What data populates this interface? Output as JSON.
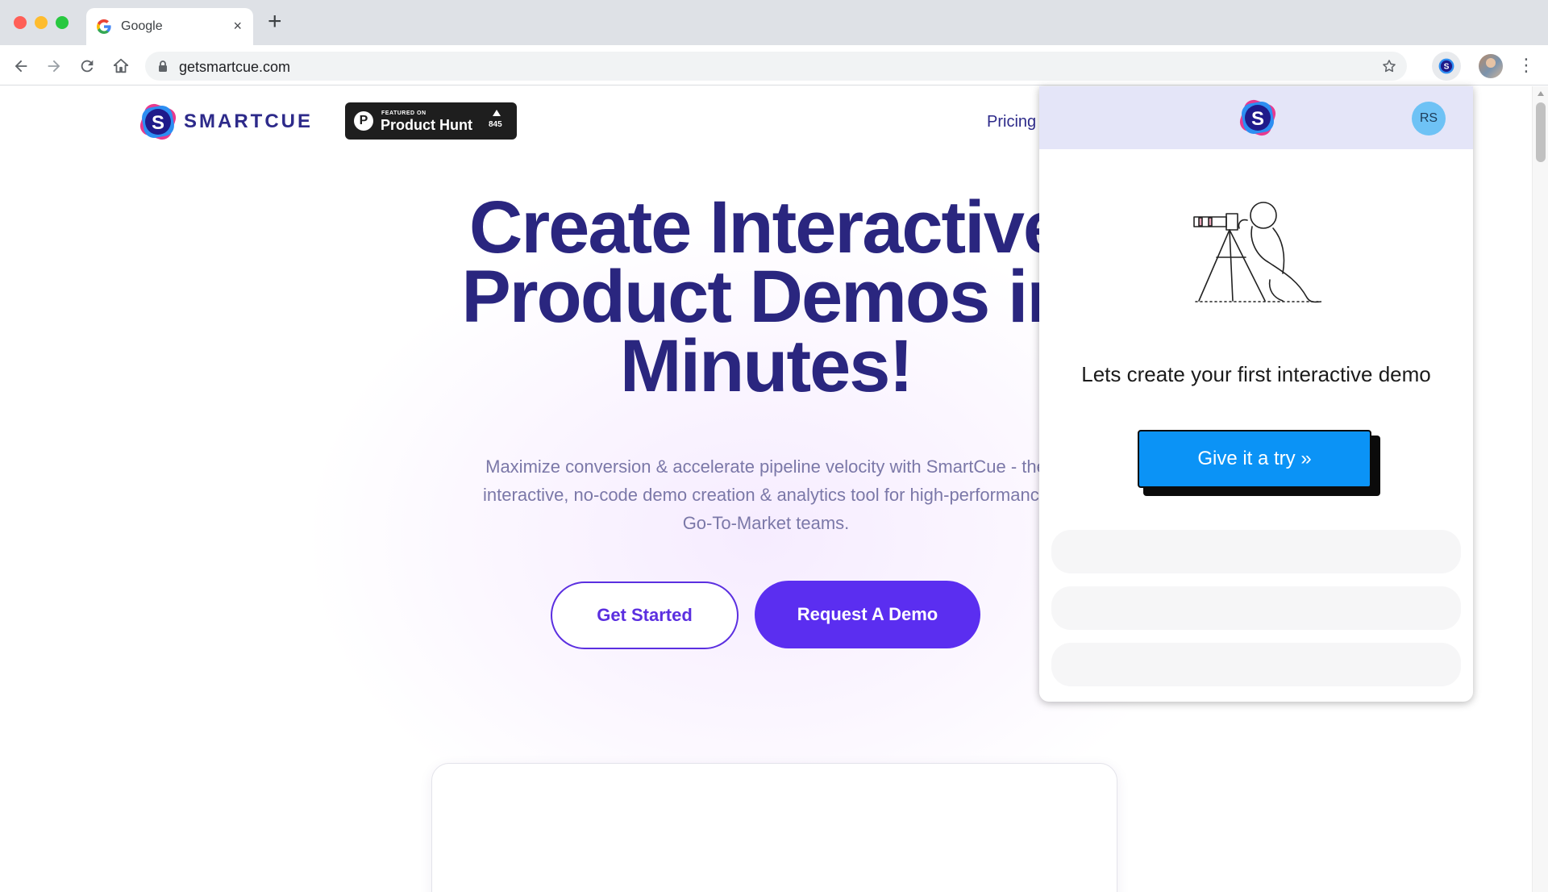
{
  "browser": {
    "tab_title": "Google",
    "tab_close": "×",
    "new_tab": "+",
    "url": "getsmartcue.com"
  },
  "site": {
    "brand": "SMARTCUE",
    "logo_letter": "S",
    "product_hunt": {
      "featured": "FEATURED ON",
      "name": "Product Hunt",
      "logo_letter": "P",
      "count": "845"
    },
    "nav": {
      "pricing": "Pricing"
    },
    "hero": {
      "title_line1": "Create Interactive",
      "title_line2": "Product Demos in",
      "title_line3": "Minutes!",
      "subtitle": "Maximize conversion & accelerate pipeline velocity with SmartCue - the interactive, no-code demo creation & analytics tool for high-performance Go-To-Market teams."
    },
    "buttons": {
      "get_started": "Get Started",
      "request_demo": "Request A Demo"
    }
  },
  "popup": {
    "logo_letter": "S",
    "avatar_initials": "RS",
    "heading": "Lets create your first interactive demo",
    "try_button": "Give it a try »"
  },
  "colors": {
    "brand_navy": "#2a267f",
    "brand_purple": "#5b2ef0",
    "popup_header": "#e4e5f8",
    "try_blue": "#0b93f6",
    "avatar_blue": "#6ec2f5"
  },
  "icons": [
    "google-favicon",
    "back-arrow-icon",
    "forward-arrow-icon",
    "reload-icon",
    "home-icon",
    "lock-icon",
    "star-icon",
    "smartcue-extension-icon",
    "profile-avatar",
    "kebab-menu-icon",
    "telescope-illustration"
  ]
}
